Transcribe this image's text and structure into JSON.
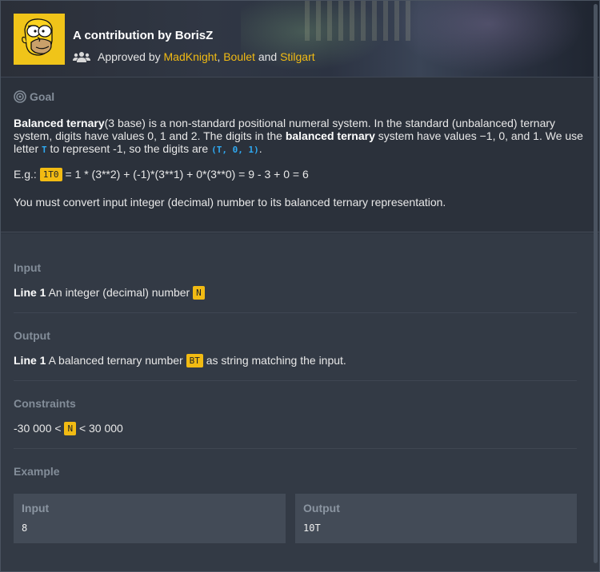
{
  "header": {
    "title": "A contribution by BorisZ",
    "approved_prefix": "Approved by",
    "approvers": [
      "MadKnight",
      "Boulet",
      "Stilgart"
    ],
    "comma": ",",
    "and": "and",
    "avatar_icon": "homer-avatar-icon",
    "users_icon": "users-icon"
  },
  "goal": {
    "label": "Goal",
    "icon": "target-icon",
    "p1_b1": "Balanced ternary",
    "p1_t1": "(3 base) is a non-standard positional numeral system. In the standard (unbalanced) ternary system, digits have values 0, 1 and 2. The digits in the ",
    "p1_b2": "balanced ternary",
    "p1_t2": " system have values −1, 0, and 1. We use letter ",
    "p1_code1": "T",
    "p1_t3": " to represent -1, so the digits are ",
    "p1_code2": "(T, 0, 1)",
    "p1_t4": ".",
    "p2_prefix": "E.g.: ",
    "p2_tag": "1T0",
    "p2_rest": " = 1 * (3**2) + (-1)*(3**1) + 0*(3**0) = 9 - 3 + 0 = 6",
    "p3": "You must convert input integer (decimal) number to its balanced ternary representation."
  },
  "input": {
    "label": "Input",
    "line_label": "Line 1",
    "text": " An integer (decimal) number ",
    "tag": "N"
  },
  "output": {
    "label": "Output",
    "line_label": "Line 1",
    "text": " A balanced ternary number ",
    "tag": "BT",
    "text2": " as string matching the input."
  },
  "constraints": {
    "label": "Constraints",
    "pre": "-30 000 < ",
    "tag": "N",
    "post": " < 30 000"
  },
  "example": {
    "label": "Example",
    "input_label": "Input",
    "input_value": "8",
    "output_label": "Output",
    "output_value": "10T"
  },
  "colors": {
    "accent": "#f2bb13",
    "code_blue": "#2fa9f1",
    "bg_dark": "#2b313b",
    "bg_panel": "#333a45"
  }
}
